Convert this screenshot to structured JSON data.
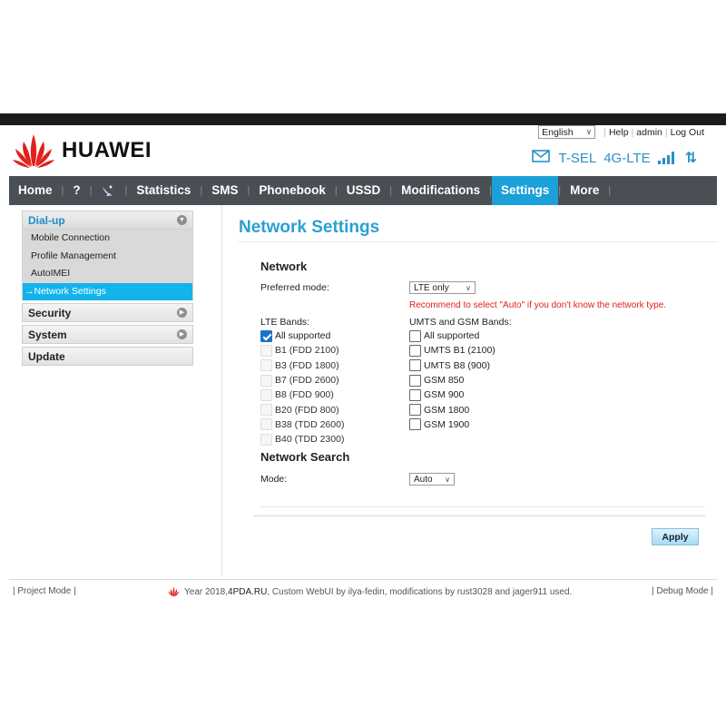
{
  "header": {
    "brand": "HUAWEI",
    "language": "English",
    "util_links": [
      "Help",
      "admin",
      "Log Out"
    ],
    "operator": "T-SEL",
    "network_type": "4G-LTE",
    "colors": {
      "accent": "#1ba0d8",
      "brand_red": "#e0201c"
    }
  },
  "nav": {
    "items": [
      {
        "label": "Home"
      },
      {
        "label": "?"
      },
      {
        "label": "Statistics"
      },
      {
        "label": "SMS"
      },
      {
        "label": "Phonebook"
      },
      {
        "label": "USSD"
      },
      {
        "label": "Modifications"
      },
      {
        "label": "Settings"
      },
      {
        "label": "More"
      }
    ],
    "active": "Settings"
  },
  "sidebar": {
    "dialup": {
      "label": "Dial-up",
      "items": [
        "Mobile Connection",
        "Profile Management",
        "AutoIMEI",
        "→Network Settings"
      ]
    },
    "security": "Security",
    "system": "System",
    "update": "Update"
  },
  "main": {
    "title": "Network Settings",
    "network_section": "Network",
    "preferred_mode_label": "Preferred mode:",
    "preferred_mode_value": "LTE only",
    "warning": "Recommend to select \"Auto\" if you don't know the network type.",
    "lte_bands_label": "LTE Bands:",
    "lte_bands": [
      {
        "label": "All supported",
        "checked": true
      },
      {
        "label": "B1 (FDD 2100)",
        "checked": false
      },
      {
        "label": "B3 (FDD 1800)",
        "checked": false
      },
      {
        "label": "B7 (FDD 2600)",
        "checked": false
      },
      {
        "label": "B8 (FDD 900)",
        "checked": false
      },
      {
        "label": "B20 (FDD 800)",
        "checked": false
      },
      {
        "label": "B38 (TDD 2600)",
        "checked": false
      },
      {
        "label": "B40 (TDD 2300)",
        "checked": false
      }
    ],
    "umts_bands_label": "UMTS and GSM Bands:",
    "umts_bands": [
      {
        "label": "All supported",
        "checked": false
      },
      {
        "label": "UMTS B1 (2100)",
        "checked": false
      },
      {
        "label": "UMTS B8 (900)",
        "checked": false
      },
      {
        "label": "GSM 850",
        "checked": false
      },
      {
        "label": "GSM 900",
        "checked": false
      },
      {
        "label": "GSM 1800",
        "checked": false
      },
      {
        "label": "GSM 1900",
        "checked": false
      }
    ],
    "search_section": "Network Search",
    "mode_label": "Mode:",
    "mode_value": "Auto",
    "apply": "Apply"
  },
  "footer": {
    "left": "Project Mode",
    "center_pre": "Year 2018, ",
    "center_site": "4PDA.RU",
    "center_post": ", Custom WebUI by ilya-fedin, modifications by rust3028 and jager911 used.",
    "right": "Debug Mode"
  }
}
